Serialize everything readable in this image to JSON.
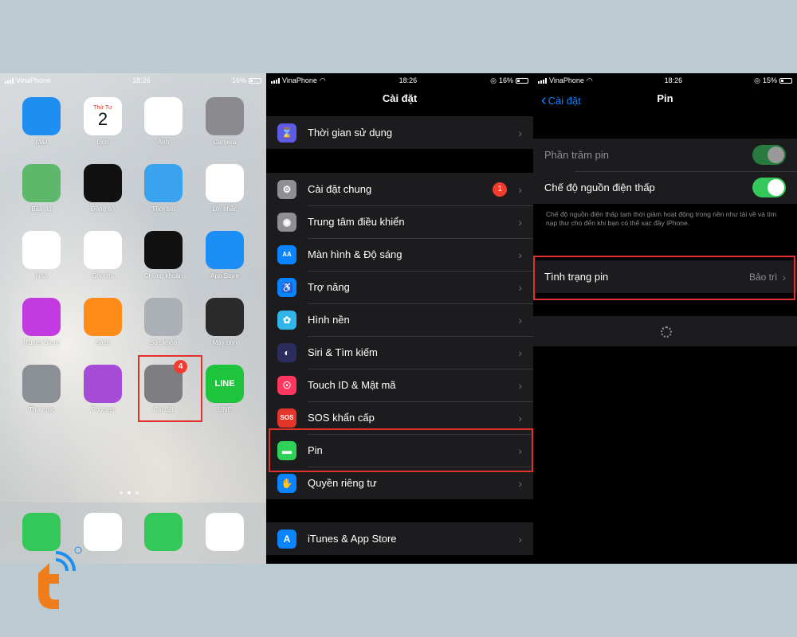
{
  "home": {
    "status": {
      "carrier": "VinaPhone",
      "time": "18:26",
      "battery": "16%"
    },
    "apps": [
      {
        "label": "Mail",
        "icon": "mail-icon",
        "color": "#1f8ef1"
      },
      {
        "label": "Lịch",
        "icon": "calendar-icon",
        "color": "#ffffff",
        "cal_day": "Thứ Tư",
        "cal_date": "2"
      },
      {
        "label": "Ảnh",
        "icon": "photos-icon",
        "color": "#ffffff"
      },
      {
        "label": "Camera",
        "icon": "camera-icon",
        "color": "#8a8a8f"
      },
      {
        "label": "Bản đồ",
        "icon": "maps-icon",
        "color": "#5db86a"
      },
      {
        "label": "Đồng hồ",
        "icon": "clock-icon",
        "color": "#111111"
      },
      {
        "label": "Thời tiết",
        "icon": "weather-icon",
        "color": "#3aa3f0"
      },
      {
        "label": "Lời nhắc",
        "icon": "reminders-icon",
        "color": "#ffffff"
      },
      {
        "label": "Nhà",
        "icon": "home-icon",
        "color": "#ffffff"
      },
      {
        "label": "Ghi chú",
        "icon": "notes-icon",
        "color": "#ffffff"
      },
      {
        "label": "Chứng khoán",
        "icon": "stocks-icon",
        "color": "#111111"
      },
      {
        "label": "App Store",
        "icon": "app-store-icon",
        "color": "#1c8ef5"
      },
      {
        "label": "iTunes Store",
        "icon": "itunes-store-icon",
        "color": "#c23be0"
      },
      {
        "label": "Sách",
        "icon": "books-icon",
        "color": "#ff8c1a"
      },
      {
        "label": "Sức khỏe",
        "icon": "health-folder-icon",
        "color": "#aab0b5"
      },
      {
        "label": "Máy tính",
        "icon": "calculator-icon",
        "color": "#2b2b2b"
      },
      {
        "label": "Thư mục",
        "icon": "folder-icon",
        "color": "#8a9096"
      },
      {
        "label": "Podcast",
        "icon": "podcast-icon",
        "color": "#a64bd8"
      },
      {
        "label": "Cài đặt",
        "icon": "settings-gear-icon",
        "color": "#7d7d82",
        "badge": "4"
      },
      {
        "label": "LINE",
        "icon": "line-icon",
        "color": "#1fc43d",
        "glyph": "LINE"
      }
    ],
    "dock": [
      {
        "icon": "phone-icon",
        "color": "#34c759"
      },
      {
        "icon": "safari-icon",
        "color": "#ffffff"
      },
      {
        "icon": "messages-icon",
        "color": "#34c759"
      },
      {
        "icon": "music-icon",
        "color": "#ffffff"
      }
    ]
  },
  "settings": {
    "status": {
      "carrier": "VinaPhone",
      "time": "18:26",
      "battery": "16%"
    },
    "title": "Cài đặt",
    "group1": [
      {
        "label": "Thời gian sử dụng",
        "icon": "hourglass-icon",
        "color": "#5e5ce6",
        "glyph": "⌛"
      }
    ],
    "group2": [
      {
        "label": "Cài đặt chung",
        "icon": "gear-icon",
        "color": "#8e8e93",
        "glyph": "⚙",
        "badge": "1"
      },
      {
        "label": "Trung tâm điều khiển",
        "icon": "control-center-icon",
        "color": "#8e8e93",
        "glyph": "◉"
      },
      {
        "label": "Màn hình & Độ sáng",
        "icon": "display-icon",
        "color": "#0a84ff",
        "glyph": "AA"
      },
      {
        "label": "Trợ năng",
        "icon": "accessibility-icon",
        "color": "#0a84ff",
        "glyph": "♿"
      },
      {
        "label": "Hình nền",
        "icon": "wallpaper-icon",
        "color": "#2fb5e8",
        "glyph": "✿"
      },
      {
        "label": "Siri & Tìm kiếm",
        "icon": "siri-icon",
        "color": "#2c2c5e",
        "glyph": "◐"
      },
      {
        "label": "Touch ID & Mật mã",
        "icon": "fingerprint-icon",
        "color": "#ff375f",
        "glyph": "☉"
      },
      {
        "label": "SOS khẩn cấp",
        "icon": "sos-icon",
        "color": "#e5352b",
        "glyph": "SOS"
      },
      {
        "label": "Pin",
        "icon": "battery-icon",
        "color": "#30d158",
        "glyph": "▬"
      },
      {
        "label": "Quyền riêng tư",
        "icon": "privacy-hand-icon",
        "color": "#0a84ff",
        "glyph": "✋"
      }
    ],
    "group3": [
      {
        "label": "iTunes & App Store",
        "icon": "app-store-icon",
        "color": "#0a84ff",
        "glyph": "A"
      }
    ]
  },
  "battery": {
    "status": {
      "carrier": "VinaPhone",
      "time": "18:26",
      "battery": "15%"
    },
    "back_label": "Cài đặt",
    "title": "Pin",
    "percent_label": "Phần trăm pin",
    "low_power_label": "Chế độ nguồn điện thấp",
    "low_power_note": "Chế độ nguồn điện thấp tạm thời giảm hoạt động trong nền như tải về và tìm nạp thư cho đến khi bạn có thể sạc đầy iPhone.",
    "health_label": "Tình trạng pin",
    "health_value": "Bảo trì"
  }
}
